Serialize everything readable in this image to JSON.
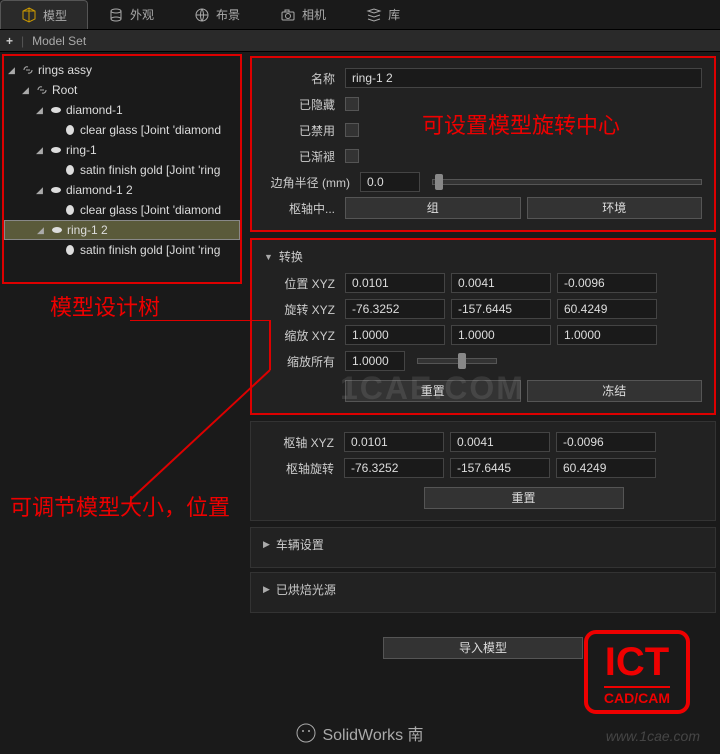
{
  "tabs": {
    "model": "模型",
    "appearance": "外观",
    "layout": "布景",
    "camera": "相机",
    "library": "库"
  },
  "subbar": {
    "modelset": "Model Set"
  },
  "tree": {
    "root0": "rings assy",
    "root1": "Root",
    "n2": "diamond-1",
    "n3": "clear glass [Joint 'diamond",
    "n4": "ring-1",
    "n5": "satin finish gold [Joint 'ring",
    "n6": "diamond-1 2",
    "n7": "clear glass [Joint 'diamond",
    "n8": "ring-1 2",
    "n9": "satin finish gold [Joint 'ring"
  },
  "annot": {
    "tree_label": "模型设计树",
    "top_label": "可设置模型旋转中心",
    "mid_label": "可调节模型大小，位置"
  },
  "p1": {
    "name_lbl": "名称",
    "name_val": "ring-1 2",
    "hidden_lbl": "已隐藏",
    "disabled_lbl": "已禁用",
    "fade_lbl": "已渐褪",
    "radius_lbl": "边角半径 (mm)",
    "radius_val": "0.0",
    "pivot_lbl": "枢轴中...",
    "group_btn": "组",
    "env_btn": "环境"
  },
  "p2": {
    "title": "转换",
    "pos_lbl": "位置 XYZ",
    "pos_x": "0.0101",
    "pos_y": "0.0041",
    "pos_z": "-0.0096",
    "rot_lbl": "旋转 XYZ",
    "rot_x": "-76.3252",
    "rot_y": "-157.6445",
    "rot_z": "60.4249",
    "scale_lbl": "缩放 XYZ",
    "scale_x": "1.0000",
    "scale_y": "1.0000",
    "scale_z": "1.0000",
    "scaleall_lbl": "缩放所有",
    "scaleall_val": "1.0000",
    "reset_btn": "重置",
    "freeze_btn": "冻结"
  },
  "p3": {
    "pivot_lbl": "枢轴 XYZ",
    "piv_x": "0.0101",
    "piv_y": "0.0041",
    "piv_z": "-0.0096",
    "pivrot_lbl": "枢轴旋转",
    "pr_x": "-76.3252",
    "pr_y": "-157.6445",
    "pr_z": "60.4249",
    "reset_btn": "重置"
  },
  "collapse": {
    "vehicle": "车辆设置",
    "baked": "已烘焙光源"
  },
  "import_btn": "导入模型",
  "footer": "SolidWorks 南",
  "footer_url": "www.1cae.com",
  "watermark": "1CAE.COM",
  "ict": {
    "big": "ICT",
    "sm": "CAD/CAM"
  }
}
